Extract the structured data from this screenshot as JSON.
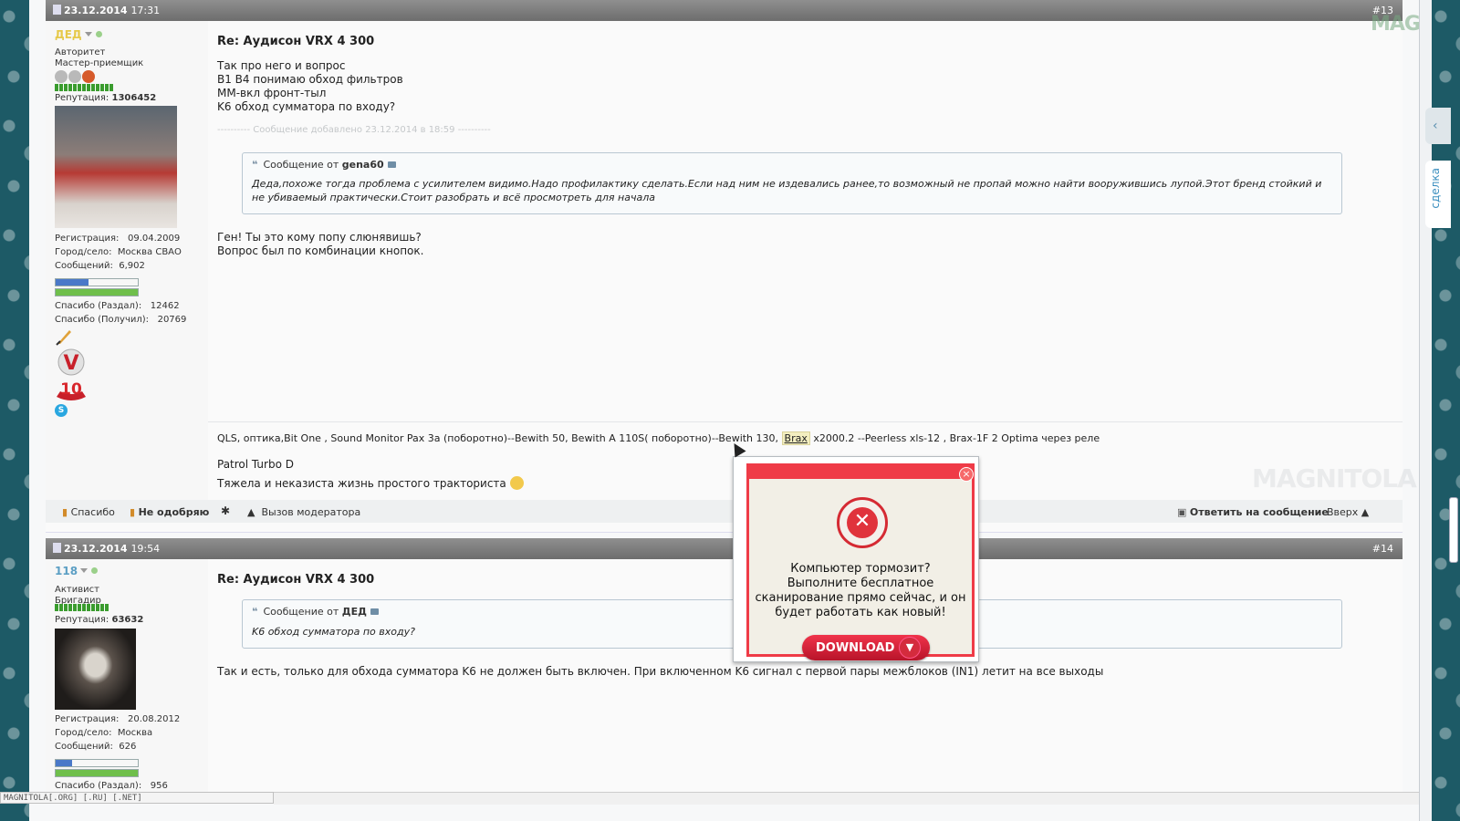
{
  "post13": {
    "date": "23.12.2014",
    "time": "17:31",
    "num": "#13",
    "user": {
      "name": "ДЕД",
      "rank1": "Авторитет",
      "rank2": "Мастер-приемщик",
      "rep_label": "Репутация:",
      "rep_value": "1306452",
      "reg_label": "Регистрация:",
      "reg_value": "09.04.2009",
      "city_label": "Город/село:",
      "city_value": "Москва СВАО",
      "msgs_label": "Сообщений:",
      "msgs_value": "6,902",
      "thanks_given_label": "Спасибо (Раздал):",
      "thanks_given_value": "12462",
      "thanks_got_label": "Спасибо (Получил):",
      "thanks_got_value": "20769"
    },
    "title": "Re: Аудисон VRX 4 300",
    "lines": [
      "Так про него и вопрос",
      "B1 B4 понимаю обход фильтров",
      "MM-вкл фронт-тыл",
      "K6 обход сумматора по входу?"
    ],
    "added_note": "---------- Сообщение добавлено 23.12.2014 в 18:59 ----------",
    "quote": {
      "prefix": "Сообщение от",
      "author": "gena60",
      "text": "Деда,похоже тогда проблема с усилителем видимо.Надо профилактику сделать.Если над ним не издевались ранее,то возможный не пропай можно найти вооружившись лупой.Этот бренд стойкий и не убиваемый практически.Стоит разобрать и всё просмотреть для начала"
    },
    "reply_lines": [
      "Ген! Ты это кому попу слюнявишь?",
      "Вопрос был по комбинации кнопок."
    ],
    "sig": {
      "part1": "QLS, оптика,Bit One , Sound Monitor Pax 3а (поборотно)--Bewith 50, Bewith A 110S( поборотно)--Bewith 130,",
      "brax": "Brax",
      "part2": "x2000.2 --Peerless xls-12 , Brax-1F 2 Optima через реле",
      "car": "Patrol Turbo D",
      "motto": "Тяжела и неказиста жизнь простого тракториста"
    },
    "toolbar": {
      "thanks": "Спасибо",
      "disapprove": "Не одобряю",
      "moderator": "Вызов модератора",
      "reply": "Ответить на сообщение",
      "top": "Вверх ▲"
    }
  },
  "post14": {
    "date": "23.12.2014",
    "time": "19:54",
    "num": "#14",
    "user": {
      "name": "118",
      "rank1": "Активист",
      "rank2": "Бригадир",
      "rep_label": "Репутация:",
      "rep_value": "63632",
      "reg_label": "Регистрация:",
      "reg_value": "20.08.2012",
      "city_label": "Город/село:",
      "city_value": "Москва",
      "msgs_label": "Сообщений:",
      "msgs_value": "626",
      "thanks_given_label": "Спасибо (Раздал):",
      "thanks_given_value": "956"
    },
    "title": "Re: Аудисон VRX 4 300",
    "quote": {
      "prefix": "Сообщение от",
      "author": "ДЕД",
      "text": "K6 обход сумматора по входу?"
    },
    "text": "Так и есть, только для обхода сумматора K6 не должен быть включен. При включенном K6 сигнал с первой пары межблоков (IN1) летит на все выходы"
  },
  "popup": {
    "message": "Компьютер тормозит? Выполните бесплатное сканирование прямо сейчас, и он будет работать как новый!",
    "download": "DOWNLOAD",
    "close": "×"
  },
  "side_tab_deal": "сделка",
  "status_bar": "MAGNITOLA[.ORG] [.RU] [.NET]",
  "logo": "MAGNITOLA",
  "colors": {
    "header": "#7a7a7a",
    "username_post13": "#e6c94a",
    "username_post14": "#5c9fc4",
    "popup_red": "#ef3b47"
  }
}
